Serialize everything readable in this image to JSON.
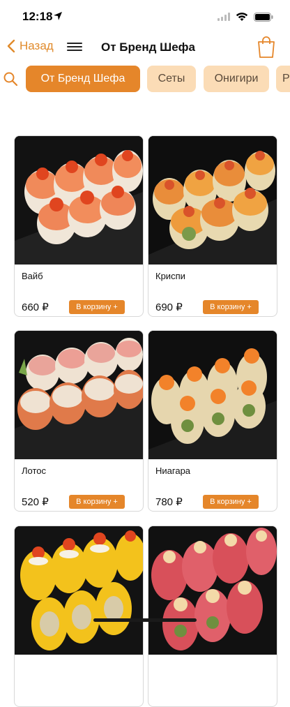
{
  "status_bar": {
    "time": "12:18"
  },
  "header": {
    "back_label": "Назад",
    "title": "От Бренд Шефа"
  },
  "categories": [
    {
      "label": "От Бренд Шефа",
      "active": true
    },
    {
      "label": "Сеты",
      "active": false
    },
    {
      "label": "Онигири",
      "active": false
    },
    {
      "label": "Р",
      "active": false
    }
  ],
  "products": [
    {
      "name": "Вайб",
      "price": "660 ₽",
      "button": "В корзину +"
    },
    {
      "name": "Криспи",
      "price": "690 ₽",
      "button": "В корзину +"
    },
    {
      "name": "Лотос",
      "price": "520 ₽",
      "button": "В корзину +"
    },
    {
      "name": "Ниагара",
      "price": "780 ₽",
      "button": "В корзину +"
    },
    {
      "name": "",
      "price": "",
      "button": ""
    },
    {
      "name": "",
      "price": "",
      "button": ""
    }
  ],
  "colors": {
    "accent": "#e5862a",
    "chip_inactive": "#fbdcb6",
    "back_text": "#e08a2b"
  }
}
